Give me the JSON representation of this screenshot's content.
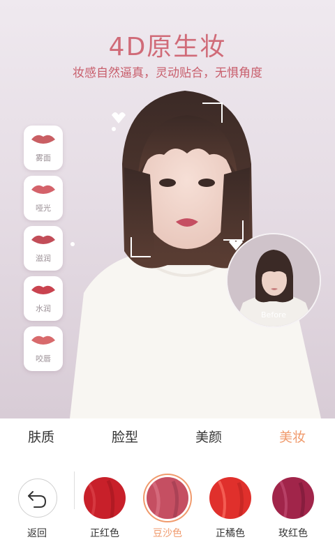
{
  "hero": {
    "title": "4D原生妆",
    "subtitle": "妆感自然逼真，灵动贴合，无惧角度",
    "before_label": "Before"
  },
  "lip_styles": [
    {
      "label": "雾面",
      "color": "#c95e63"
    },
    {
      "label": "哑光",
      "color": "#d4626a"
    },
    {
      "label": "滋润",
      "color": "#c24d58"
    },
    {
      "label": "水润",
      "color": "#c9434f"
    },
    {
      "label": "咬唇",
      "color": "#d86a6c"
    }
  ],
  "tabs": [
    {
      "label": "肤质",
      "active": false
    },
    {
      "label": "脸型",
      "active": false
    },
    {
      "label": "美颜",
      "active": false
    },
    {
      "label": "美妆",
      "active": true
    }
  ],
  "bottom": {
    "back_label": "返回",
    "colors": [
      {
        "label": "正红色",
        "hex": "#c8202a",
        "selected": false
      },
      {
        "label": "豆沙色",
        "hex": "#c54f62",
        "selected": true
      },
      {
        "label": "正橘色",
        "hex": "#e0302c",
        "selected": false
      },
      {
        "label": "玫红色",
        "hex": "#a1254a",
        "selected": false
      }
    ]
  },
  "colors": {
    "accent": "#f09a6c",
    "title": "#d06b78"
  }
}
